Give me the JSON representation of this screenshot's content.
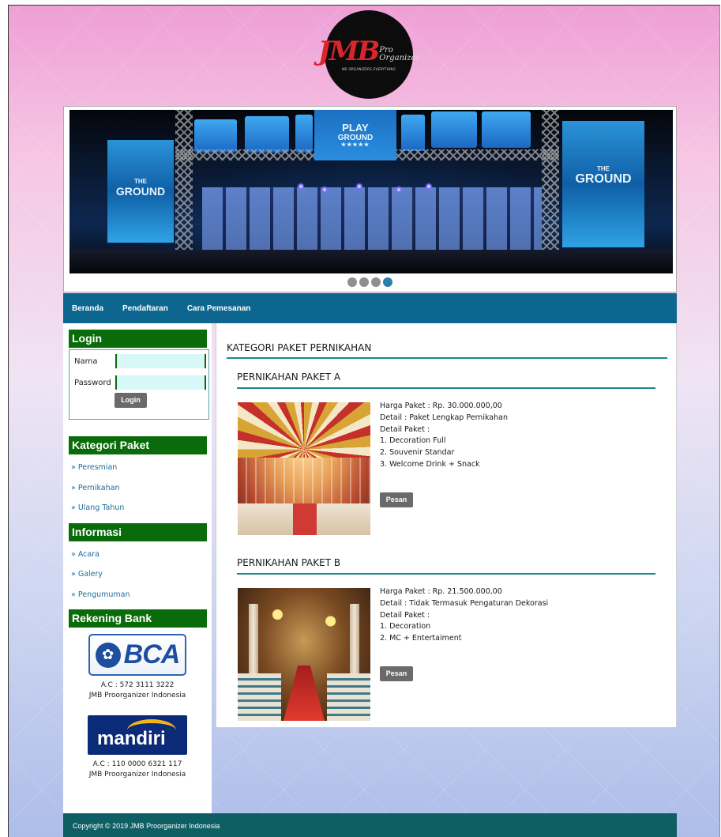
{
  "logo": {
    "main": "JMB",
    "pro": "Pro",
    "org": "Organizer",
    "tagline": "WE ORGANIZERS EVERYTHING"
  },
  "slider": {
    "sign_top": "PLAY",
    "sign_bottom": "GROUND",
    "banner_left_top": "THE",
    "banner_left_bottom": "GROUND",
    "banner_right_top": "THE",
    "banner_right_bottom": "GROUND",
    "dots_count": 4,
    "active_dot": 4
  },
  "nav": {
    "items": [
      "Beranda",
      "Pendaftaran",
      "Cara Pemesanan"
    ]
  },
  "login": {
    "heading": "Login",
    "name_label": "Nama",
    "password_label": "Password",
    "name_value": "",
    "password_value": "",
    "button": "Login"
  },
  "kategori": {
    "heading": "Kategori Paket",
    "items": [
      "» Peresmian",
      "» Pernikahan",
      "» Ulang Tahun"
    ]
  },
  "informasi": {
    "heading": "Informasi",
    "items": [
      "» Acara",
      "» Galery",
      "» Pengumuman"
    ]
  },
  "rekening": {
    "heading": "Rekening Bank",
    "banks": [
      {
        "logo_text": "BCA",
        "account": "A.C : 572 3111 3222",
        "holder": "JMB Proorganizer Indonesia"
      },
      {
        "logo_text": "mandiri",
        "account": "A.C : 110 0000 6321 117",
        "holder": "JMB Proorganizer Indonesia"
      }
    ]
  },
  "main": {
    "title": "KATEGORI PAKET PERNIKAHAN",
    "packages": [
      {
        "title": "PERNIKAHAN PAKET A",
        "lines": [
          "Harga Paket : Rp. 30.000.000,00",
          "Detail : Paket Lengkap Pernikahan",
          "Detail Paket :",
          "1. Decoration Full",
          "2. Souvenir Standar",
          "3. Welcome Drink + Snack"
        ],
        "button": "Pesan"
      },
      {
        "title": "PERNIKAHAN PAKET B",
        "lines": [
          "Harga Paket : Rp. 21.500.000,00",
          "Detail : Tidak Termasuk Pengaturan Dekorasi",
          "Detail Paket :",
          "1. Decoration",
          "2. MC + Entertaiment"
        ],
        "button": "Pesan"
      }
    ]
  },
  "footer": {
    "text": "Copyright © 2019 JMB Proorganizer Indonesia"
  },
  "colors": {
    "nav_bg": "#0c6690",
    "sidebar_heading_bg": "#0a6b0a",
    "footer_bg": "#0e5f63",
    "link": "#1d6c9c",
    "button_bg": "#6a6a6a",
    "rule": "#1c8a8a"
  }
}
